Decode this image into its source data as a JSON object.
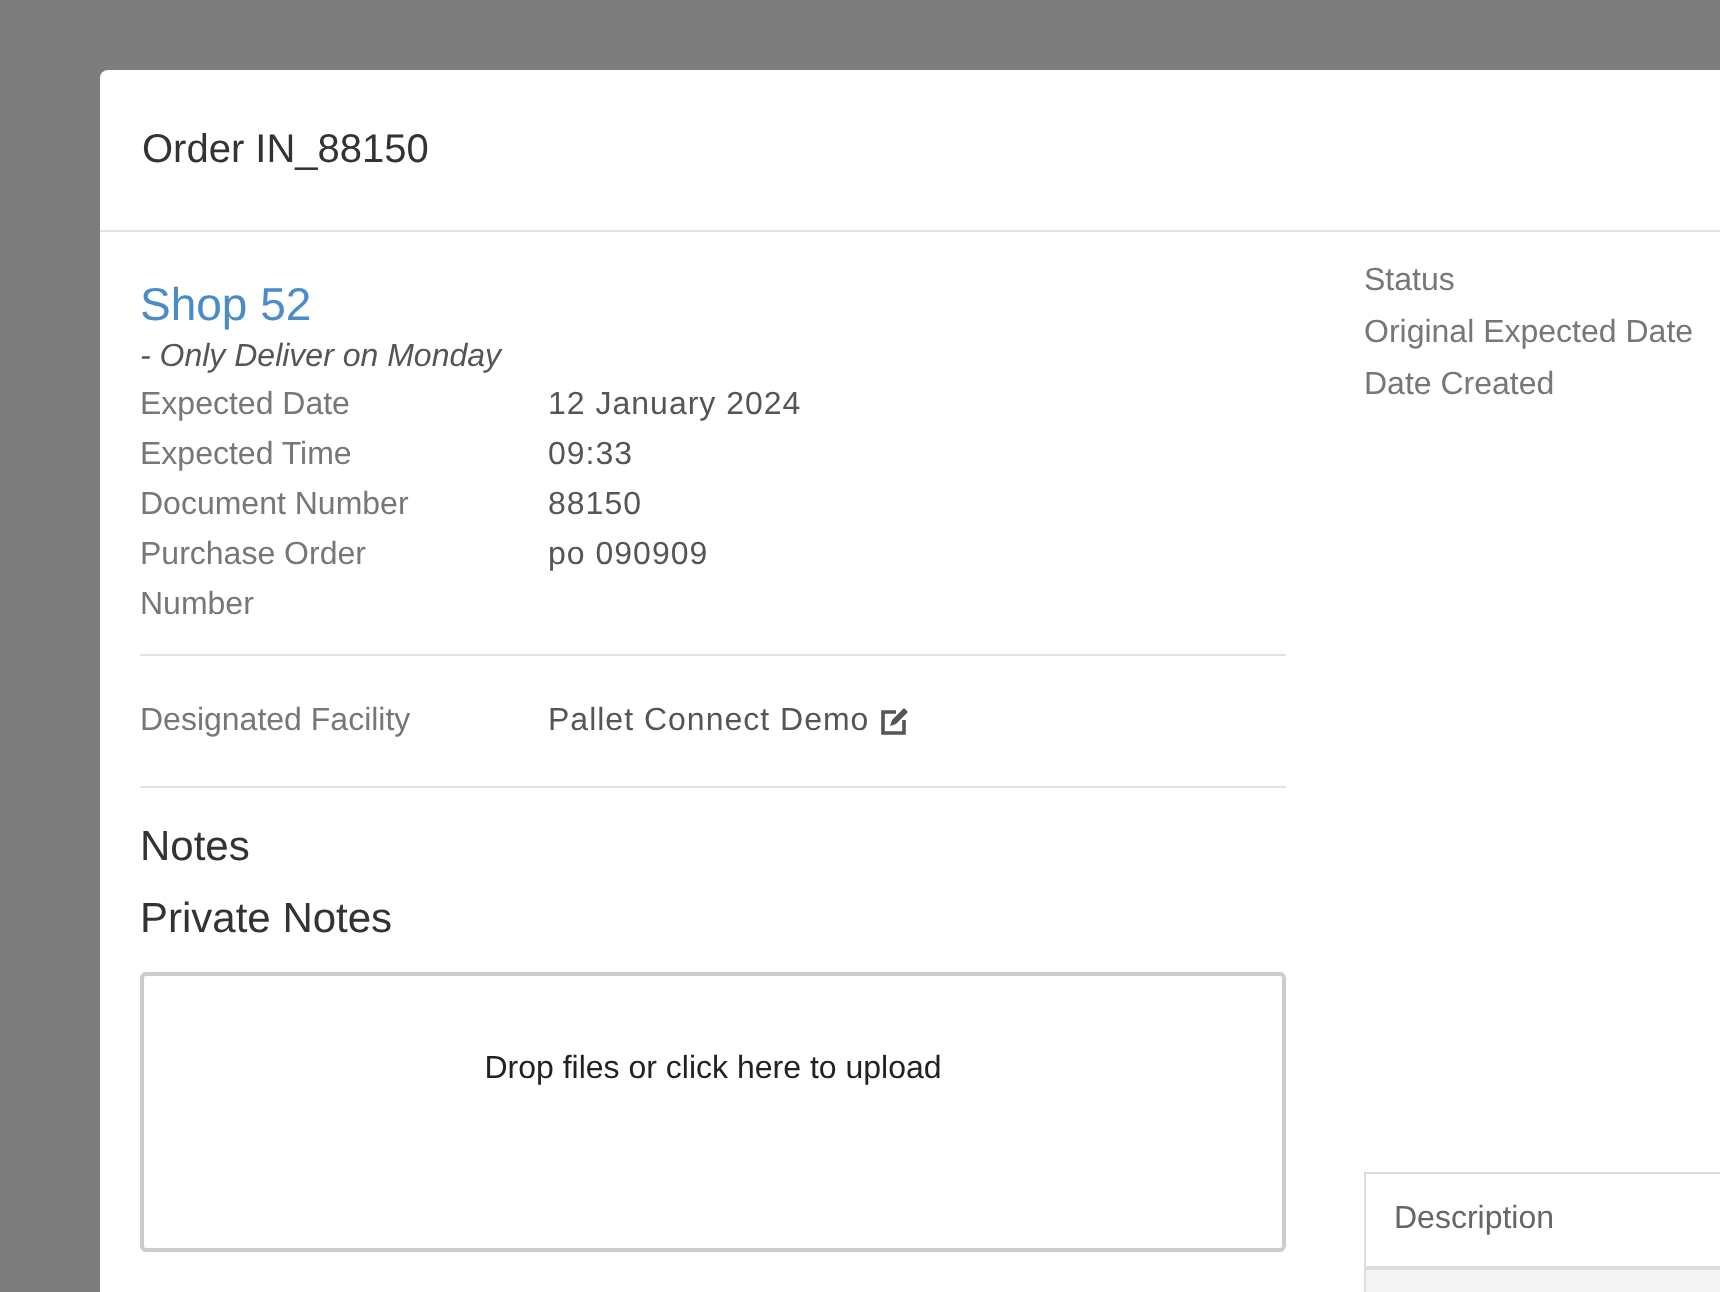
{
  "modal": {
    "title": "Order IN_88150"
  },
  "customer": {
    "name": "Shop 52",
    "note": "- Only Deliver on Monday"
  },
  "details": [
    {
      "label": "Expected Date",
      "value": "12 January 2024"
    },
    {
      "label": "Expected Time",
      "value": "09:33"
    },
    {
      "label": "Document Number",
      "value": "88150"
    },
    {
      "label": "Purchase Order Number",
      "value": "po 090909"
    }
  ],
  "facility": {
    "label": "Designated Facility",
    "value": "Pallet Connect Demo"
  },
  "notes": {
    "heading": "Notes"
  },
  "private_notes": {
    "heading": "Private Notes",
    "upload_text": "Drop files or click here to upload"
  },
  "status_labels": [
    "Status",
    "Original Expected Date",
    "Date Created"
  ],
  "table": {
    "columns": [
      "Description"
    ]
  }
}
